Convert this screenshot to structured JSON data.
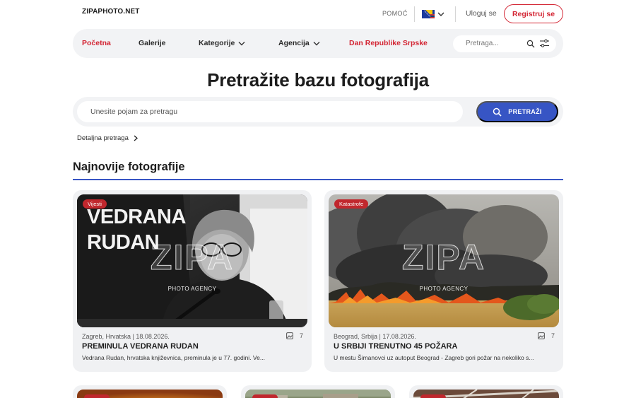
{
  "header": {
    "logo": "ZIPAPHOTO.NET",
    "help": "POMOĆ",
    "login": "Uloguj se",
    "register": "Registruj se"
  },
  "nav": {
    "items": [
      {
        "label": "Početna",
        "active": true
      },
      {
        "label": "Galerije"
      },
      {
        "label": "Kategorije",
        "dropdown": true
      },
      {
        "label": "Agencija",
        "dropdown": true
      },
      {
        "label": "Dan Republike Srpske",
        "highlight": true
      }
    ],
    "search_placeholder": "Pretraga..."
  },
  "hero": {
    "title": "Pretražite bazu fotografija",
    "search_placeholder": "Unesite pojam za pretragu",
    "search_button": "PRETRAŽI",
    "advanced": "Detaljna pretraga"
  },
  "section": {
    "title": "Najnovije fotografije"
  },
  "cards": [
    {
      "category": "Vijesti",
      "watermark": "ZIPA",
      "watermark_sub": "PHOTO AGENCY",
      "image_sign": "VEDRANA RUDAN",
      "meta": "Zagreb, Hrvatska | 18.08.2026.",
      "count": "7",
      "title": "PREMINULA VEDRANA RUDAN",
      "desc": "Vedrana Rudan, hrvatska književnica, preminula je u 77. godini. Ve..."
    },
    {
      "category": "Katastrofe",
      "watermark": "ZIPA",
      "watermark_sub": "PHOTO AGENCY",
      "meta": "Beograd, Srbija | 17.08.2026.",
      "count": "7",
      "title": "U SRBIJI TRENUTNO 45 POŽARA",
      "desc": "U mestu Šimanovci uz autoput Beograd - Zagreb gori požar na nekoliko s..."
    }
  ],
  "colors": {
    "accent_blue": "#3755c4",
    "brand_red": "#d32533",
    "badge_red": "#c1272d",
    "panel_gray": "#f2f3f5"
  },
  "icons": {
    "lang_flag": "bosnia-flag-icon",
    "chevron": "chevron-down-icon",
    "search": "search-icon",
    "filter": "filter-sliders-icon",
    "chevron_right": "chevron-right-icon",
    "gallery": "gallery-icon"
  }
}
